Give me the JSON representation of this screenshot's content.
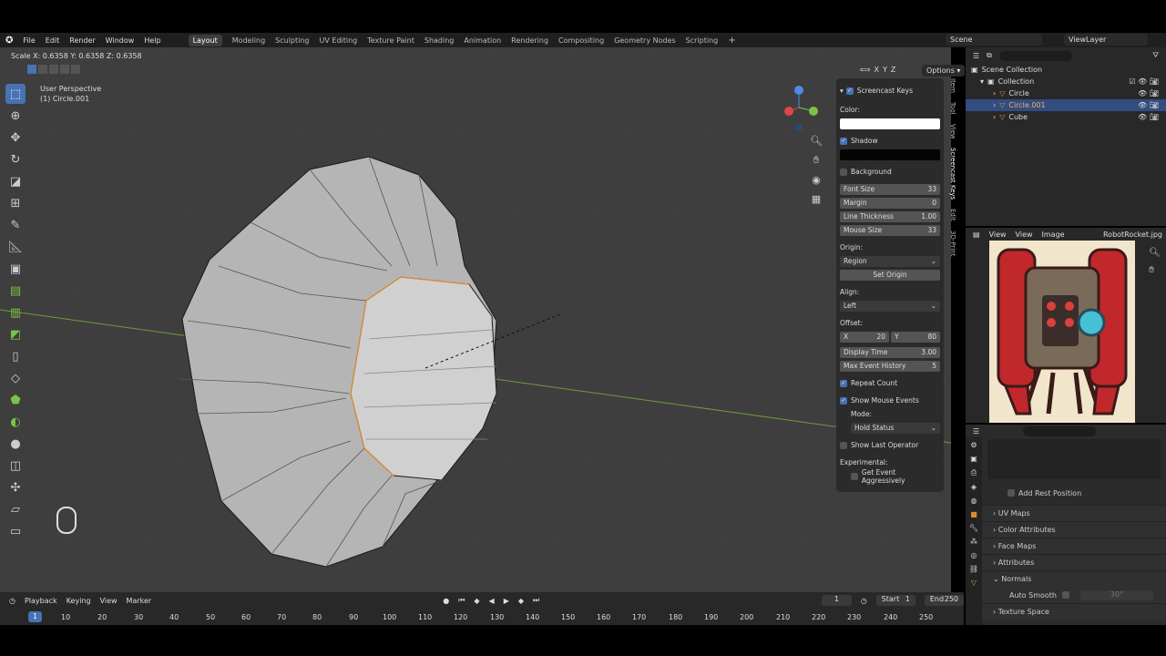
{
  "menu": [
    "File",
    "Edit",
    "Render",
    "Window",
    "Help"
  ],
  "workspaces": [
    "Layout",
    "Modeling",
    "Sculpting",
    "UV Editing",
    "Texture Paint",
    "Shading",
    "Animation",
    "Rendering",
    "Compositing",
    "Geometry Nodes",
    "Scripting"
  ],
  "active_workspace": "Layout",
  "scene": "Scene",
  "view_layer": "ViewLayer",
  "status_scale": "Scale X: 0.6358   Y: 0.6358   Z: 0.6358",
  "viewport": {
    "perspective": "User Perspective",
    "object": "(1) Circle.001",
    "options": "Options"
  },
  "npanel": {
    "title": "Screencast Keys",
    "color_label": "Color:",
    "shadow": "Shadow",
    "background": "Background",
    "font_size_label": "Font Size",
    "font_size": "33",
    "margin_label": "Margin",
    "margin": "0",
    "line_thickness_label": "Line Thickness",
    "line_thickness": "1.00",
    "mouse_size_label": "Mouse Size",
    "mouse_size": "33",
    "origin_label": "Origin:",
    "origin": "Region",
    "set_origin": "Set Origin",
    "align_label": "Align:",
    "align": "Left",
    "offset_label": "Offset:",
    "offset_x_label": "X",
    "offset_x": "20",
    "offset_y_label": "Y",
    "offset_y": "80",
    "display_time_label": "Display Time",
    "display_time": "3.00",
    "max_event_label": "Max Event History",
    "max_event": "5",
    "repeat_count": "Repeat Count",
    "show_mouse": "Show Mouse Events",
    "mode_label": "Mode:",
    "mode": "Hold Status",
    "show_last": "Show Last Operator",
    "experimental": "Experimental:",
    "get_event": "Get Event Aggressively"
  },
  "vtabs": [
    "Item",
    "Tool",
    "View",
    "Screencast Keys",
    "Edit",
    "3D-Print"
  ],
  "outliner": {
    "scene_collection": "Scene Collection",
    "collection": "Collection",
    "items": [
      "Circle",
      "Circle.001",
      "Cube"
    ]
  },
  "image_editor": {
    "menus": [
      "View",
      "View",
      "Image"
    ],
    "image_name": "RobotRocket.jpg"
  },
  "properties": {
    "add_rest": "Add Rest Position",
    "sections": [
      "UV Maps",
      "Color Attributes",
      "Face Maps",
      "Attributes",
      "Normals"
    ],
    "auto_smooth": "Auto Smooth",
    "angle": "30°",
    "texture_space": "Texture Space"
  },
  "timeline": {
    "menus": [
      "Playback",
      "Keying",
      "View",
      "Marker"
    ],
    "frame": "1",
    "start_label": "Start",
    "start": "1",
    "end_label": "End",
    "end": "250",
    "ticks": [
      "1",
      "10",
      "20",
      "30",
      "40",
      "50",
      "60",
      "70",
      "80",
      "90",
      "100",
      "110",
      "120",
      "130",
      "140",
      "150",
      "160",
      "170",
      "180",
      "190",
      "200",
      "210",
      "220",
      "230",
      "240",
      "250"
    ]
  },
  "colors": {
    "accent": "#4772b3",
    "orange": "#e38a2e",
    "x_axis": "#e04545",
    "y_axis": "#7cc244",
    "z_axis": "#4d8ae6"
  }
}
